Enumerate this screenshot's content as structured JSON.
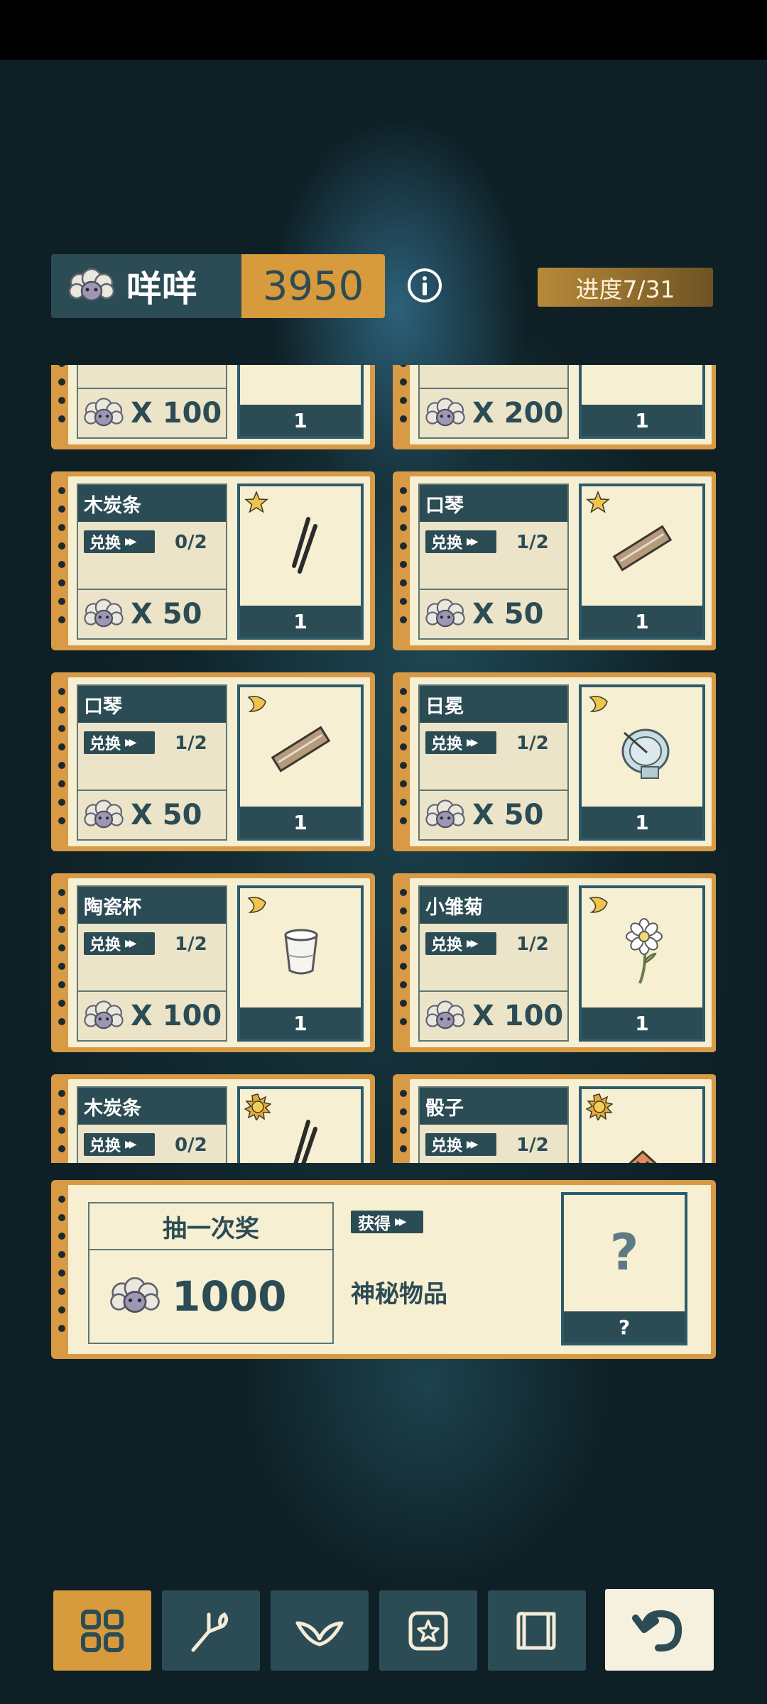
{
  "currency": {
    "name": "咩咩",
    "amount": "3950",
    "icon": "sheep-icon"
  },
  "info_icon": "info-icon",
  "progress": {
    "label": "进度7/31"
  },
  "cards": [
    {
      "title": "",
      "exchange_label": "",
      "count": "",
      "price": "X 100",
      "qty": "1",
      "rarity_icon": "",
      "art_icon": "",
      "partial": true
    },
    {
      "title": "",
      "exchange_label": "",
      "count": "",
      "price": "X 200",
      "qty": "1",
      "rarity_icon": "",
      "art_icon": "",
      "partial": true
    },
    {
      "title": "木炭条",
      "exchange_label": "兑换",
      "count": "0/2",
      "price": "X 50",
      "qty": "1",
      "rarity_icon": "star-icon",
      "art_icon": "charcoal-icon"
    },
    {
      "title": "口琴",
      "exchange_label": "兑换",
      "count": "1/2",
      "price": "X 50",
      "qty": "1",
      "rarity_icon": "star-icon",
      "art_icon": "harmonica-icon"
    },
    {
      "title": "口琴",
      "exchange_label": "兑换",
      "count": "1/2",
      "price": "X 50",
      "qty": "1",
      "rarity_icon": "moon-icon",
      "art_icon": "harmonica-icon"
    },
    {
      "title": "日冕",
      "exchange_label": "兑换",
      "count": "1/2",
      "price": "X 50",
      "qty": "1",
      "rarity_icon": "moon-icon",
      "art_icon": "sundial-icon"
    },
    {
      "title": "陶瓷杯",
      "exchange_label": "兑换",
      "count": "1/2",
      "price": "X 100",
      "qty": "1",
      "rarity_icon": "moon-icon",
      "art_icon": "cup-icon"
    },
    {
      "title": "小雏菊",
      "exchange_label": "兑换",
      "count": "1/2",
      "price": "X 100",
      "qty": "1",
      "rarity_icon": "moon-icon",
      "art_icon": "daisy-icon"
    },
    {
      "title": "木炭条",
      "exchange_label": "兑换",
      "count": "0/2",
      "price": "",
      "qty": "",
      "rarity_icon": "sun-icon",
      "art_icon": "charcoal-icon",
      "partial": true
    },
    {
      "title": "骰子",
      "exchange_label": "兑换",
      "count": "1/2",
      "price": "",
      "qty": "",
      "rarity_icon": "sun-icon",
      "art_icon": "dice-icon",
      "partial": true
    }
  ],
  "prize": {
    "title": "抽一次奖",
    "cost": "1000",
    "get_label": "获得",
    "item_name": "神秘物品",
    "item_symbol": "?",
    "qty": "?"
  },
  "nav": [
    {
      "name": "grid-icon",
      "active": true
    },
    {
      "name": "branch-icon",
      "active": false
    },
    {
      "name": "leaf-icon",
      "active": false
    },
    {
      "name": "star-box-icon",
      "active": false
    },
    {
      "name": "map-scroll-icon",
      "active": false
    }
  ],
  "back": {
    "name": "back-arrow-icon"
  }
}
